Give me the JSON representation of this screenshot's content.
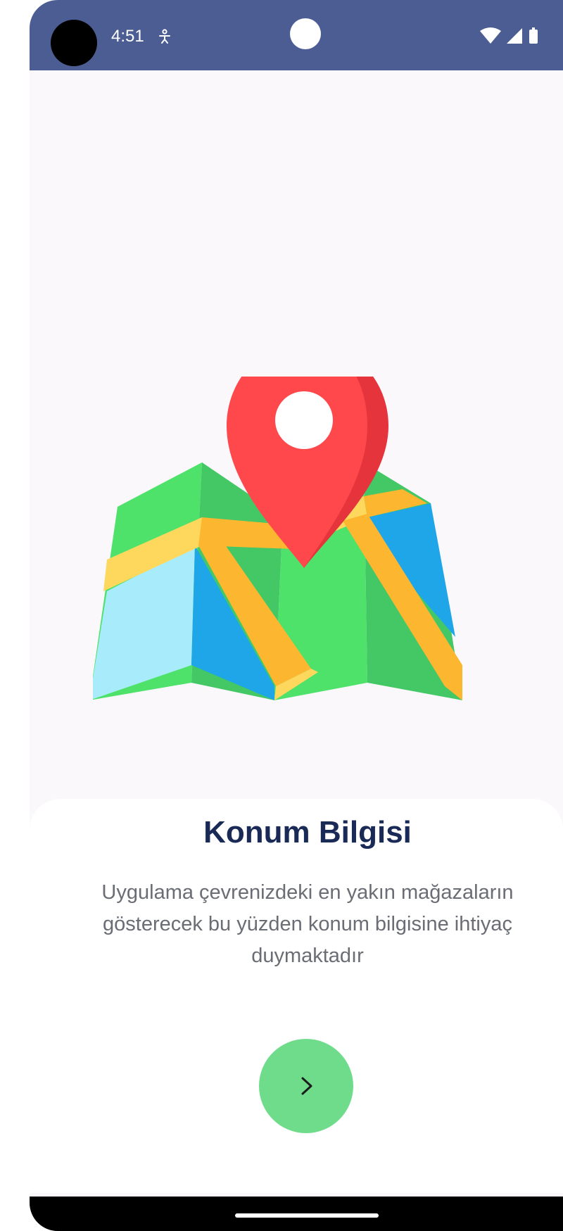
{
  "status_bar": {
    "time": "4:51",
    "accessibility_icon": "accessibility-icon",
    "wifi_icon": "wifi-icon",
    "signal_icon": "cellular-signal-icon",
    "battery_icon": "battery-icon",
    "background": "#4c5d93"
  },
  "illustration": {
    "icon": "map-location-pin-icon"
  },
  "onboarding": {
    "title": "Konum Bilgisi",
    "description": "Uygulama çevrenizdeki en yakın mağazaların gösterecek bu yüzden konum bilgisine ihtiyaç duymaktadır",
    "next_icon": "chevron-right-icon",
    "button_color": "#6fdc8c",
    "title_color": "#1a2a57"
  },
  "navigation": {
    "home_indicator": "home-indicator"
  }
}
